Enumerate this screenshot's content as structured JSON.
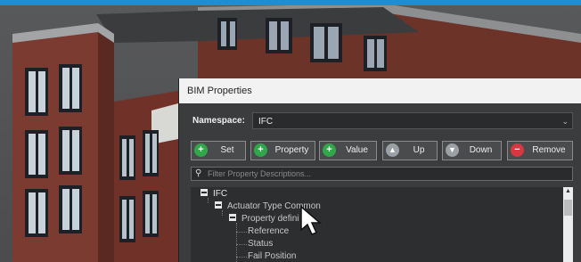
{
  "dialog": {
    "title": "BIM Properties",
    "namespace_label": "Namespace:",
    "namespace_value": "IFC",
    "buttons": [
      {
        "label": "Set",
        "icon": "plus-icon"
      },
      {
        "label": "Property",
        "icon": "plus-icon"
      },
      {
        "label": "Value",
        "icon": "plus-icon"
      },
      {
        "label": "Up",
        "icon": "arrow-up-icon"
      },
      {
        "label": "Down",
        "icon": "arrow-down-icon"
      },
      {
        "label": "Remove",
        "icon": "minus-icon"
      }
    ],
    "filter_placeholder": "Filter Property Descriptions...",
    "tree": [
      {
        "label": "IFC"
      },
      {
        "label": "Actuator Type Common"
      },
      {
        "label": "Property defini"
      },
      {
        "label": "Reference"
      },
      {
        "label": "Status"
      },
      {
        "label": "Fail Position"
      }
    ]
  },
  "colors": {
    "accent_bar": "#1a8fd8",
    "brick": "#7a3a2f",
    "add_icon": "#2fa84a",
    "remove_icon": "#d9373f"
  }
}
